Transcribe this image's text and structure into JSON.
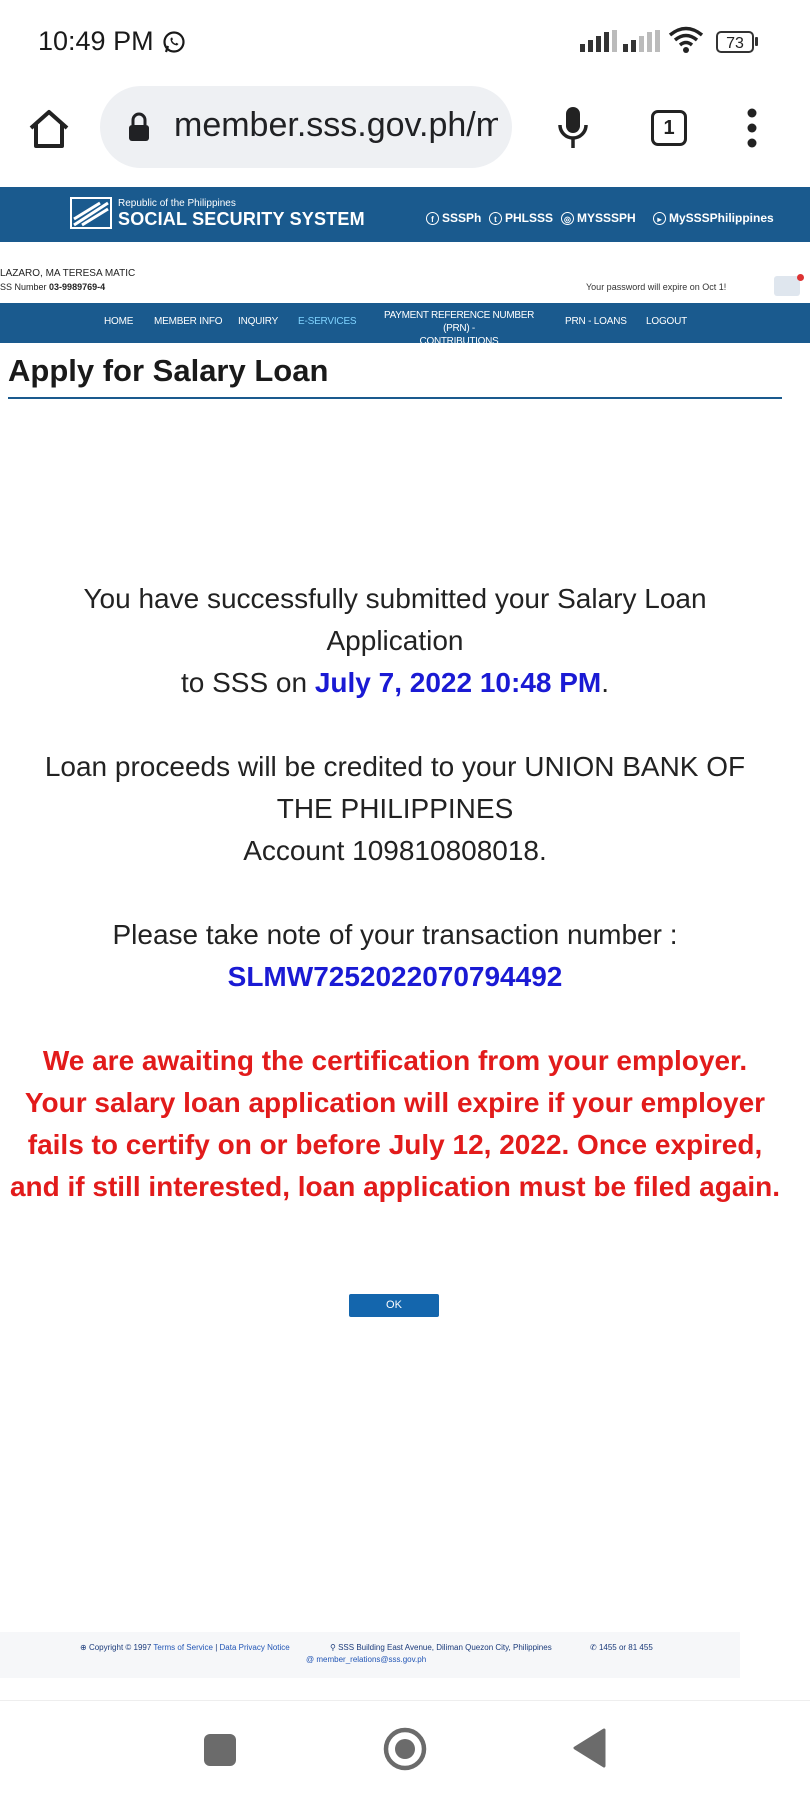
{
  "status_bar": {
    "time": "10:49 PM",
    "battery": "73",
    "icons": [
      "whatsapp-icon",
      "signal-icon",
      "signal-icon",
      "wifi-icon",
      "battery-icon"
    ]
  },
  "browser": {
    "url": "member.sss.gov.ph/m",
    "tab_count": "1",
    "icons": [
      "home-icon",
      "lock-icon",
      "mic-icon",
      "tabs-icon",
      "more-vertical-icon"
    ]
  },
  "sss_header": {
    "republic": "Republic of the Philippines",
    "title": "SOCIAL SECURITY SYSTEM",
    "social": [
      {
        "icon": "facebook-icon",
        "label": "SSSPh"
      },
      {
        "icon": "twitter-icon",
        "label": "PHLSSS"
      },
      {
        "icon": "instagram-icon",
        "label": "MYSSSPH"
      },
      {
        "icon": "youtube-icon",
        "label": "MySSSPhilippines"
      }
    ]
  },
  "member": {
    "name": "LAZARO, MA TERESA MATIC",
    "ss_label": "SS Number",
    "ss_number": "03-9989769-4",
    "password_notice": "Your password will expire on Oct 1!"
  },
  "nav": {
    "home": "HOME",
    "member_info": "MEMBER INFO",
    "inquiry": "INQUIRY",
    "eservices": "E-SERVICES",
    "prn_line1": "PAYMENT REFERENCE NUMBER (PRN) -",
    "prn_line2": "CONTRIBUTIONS",
    "prn_loans": "PRN - LOANS",
    "logout": "LOGOUT"
  },
  "page": {
    "title": "Apply for Salary Loan",
    "msg1_line1": "You have successfully submitted your Salary Loan",
    "msg1_line2": "Application",
    "msg1_prefix": "to SSS on ",
    "msg1_date": "July 7, 2022 10:48 PM",
    "msg1_suffix": ".",
    "msg2_line1": "Loan proceeds will be credited to your UNION BANK OF",
    "msg2_line2": "THE PHILIPPINES",
    "msg2_line3": "Account 109810808018.",
    "msg3_line1": "Please take note of your transaction number :",
    "transaction_number": "SLMW725202207079449 2",
    "warning_line1": "We are awaiting the certification from your employer.",
    "warning_line2": "Your salary loan application will expire if your employer",
    "warning_line3": "fails to certify on or before July 12, 2022. Once expired,",
    "warning_line4": "and if still interested, loan application must be filed again.",
    "ok_label": "OK"
  },
  "footer": {
    "copyright": "Copyright © 1997",
    "terms": "Terms of Service",
    "privacy": "Data Privacy Notice",
    "address": "SSS Building East Avenue, Diliman Quezon City, Philippines",
    "phone": "1455 or 81 455",
    "email": "member_relations@sss.gov.ph"
  },
  "colors": {
    "sss_blue": "#1a5a8e",
    "link_blue": "#1a1ad4",
    "warning_red": "#e21b1b",
    "ok_button": "#1466ad"
  }
}
